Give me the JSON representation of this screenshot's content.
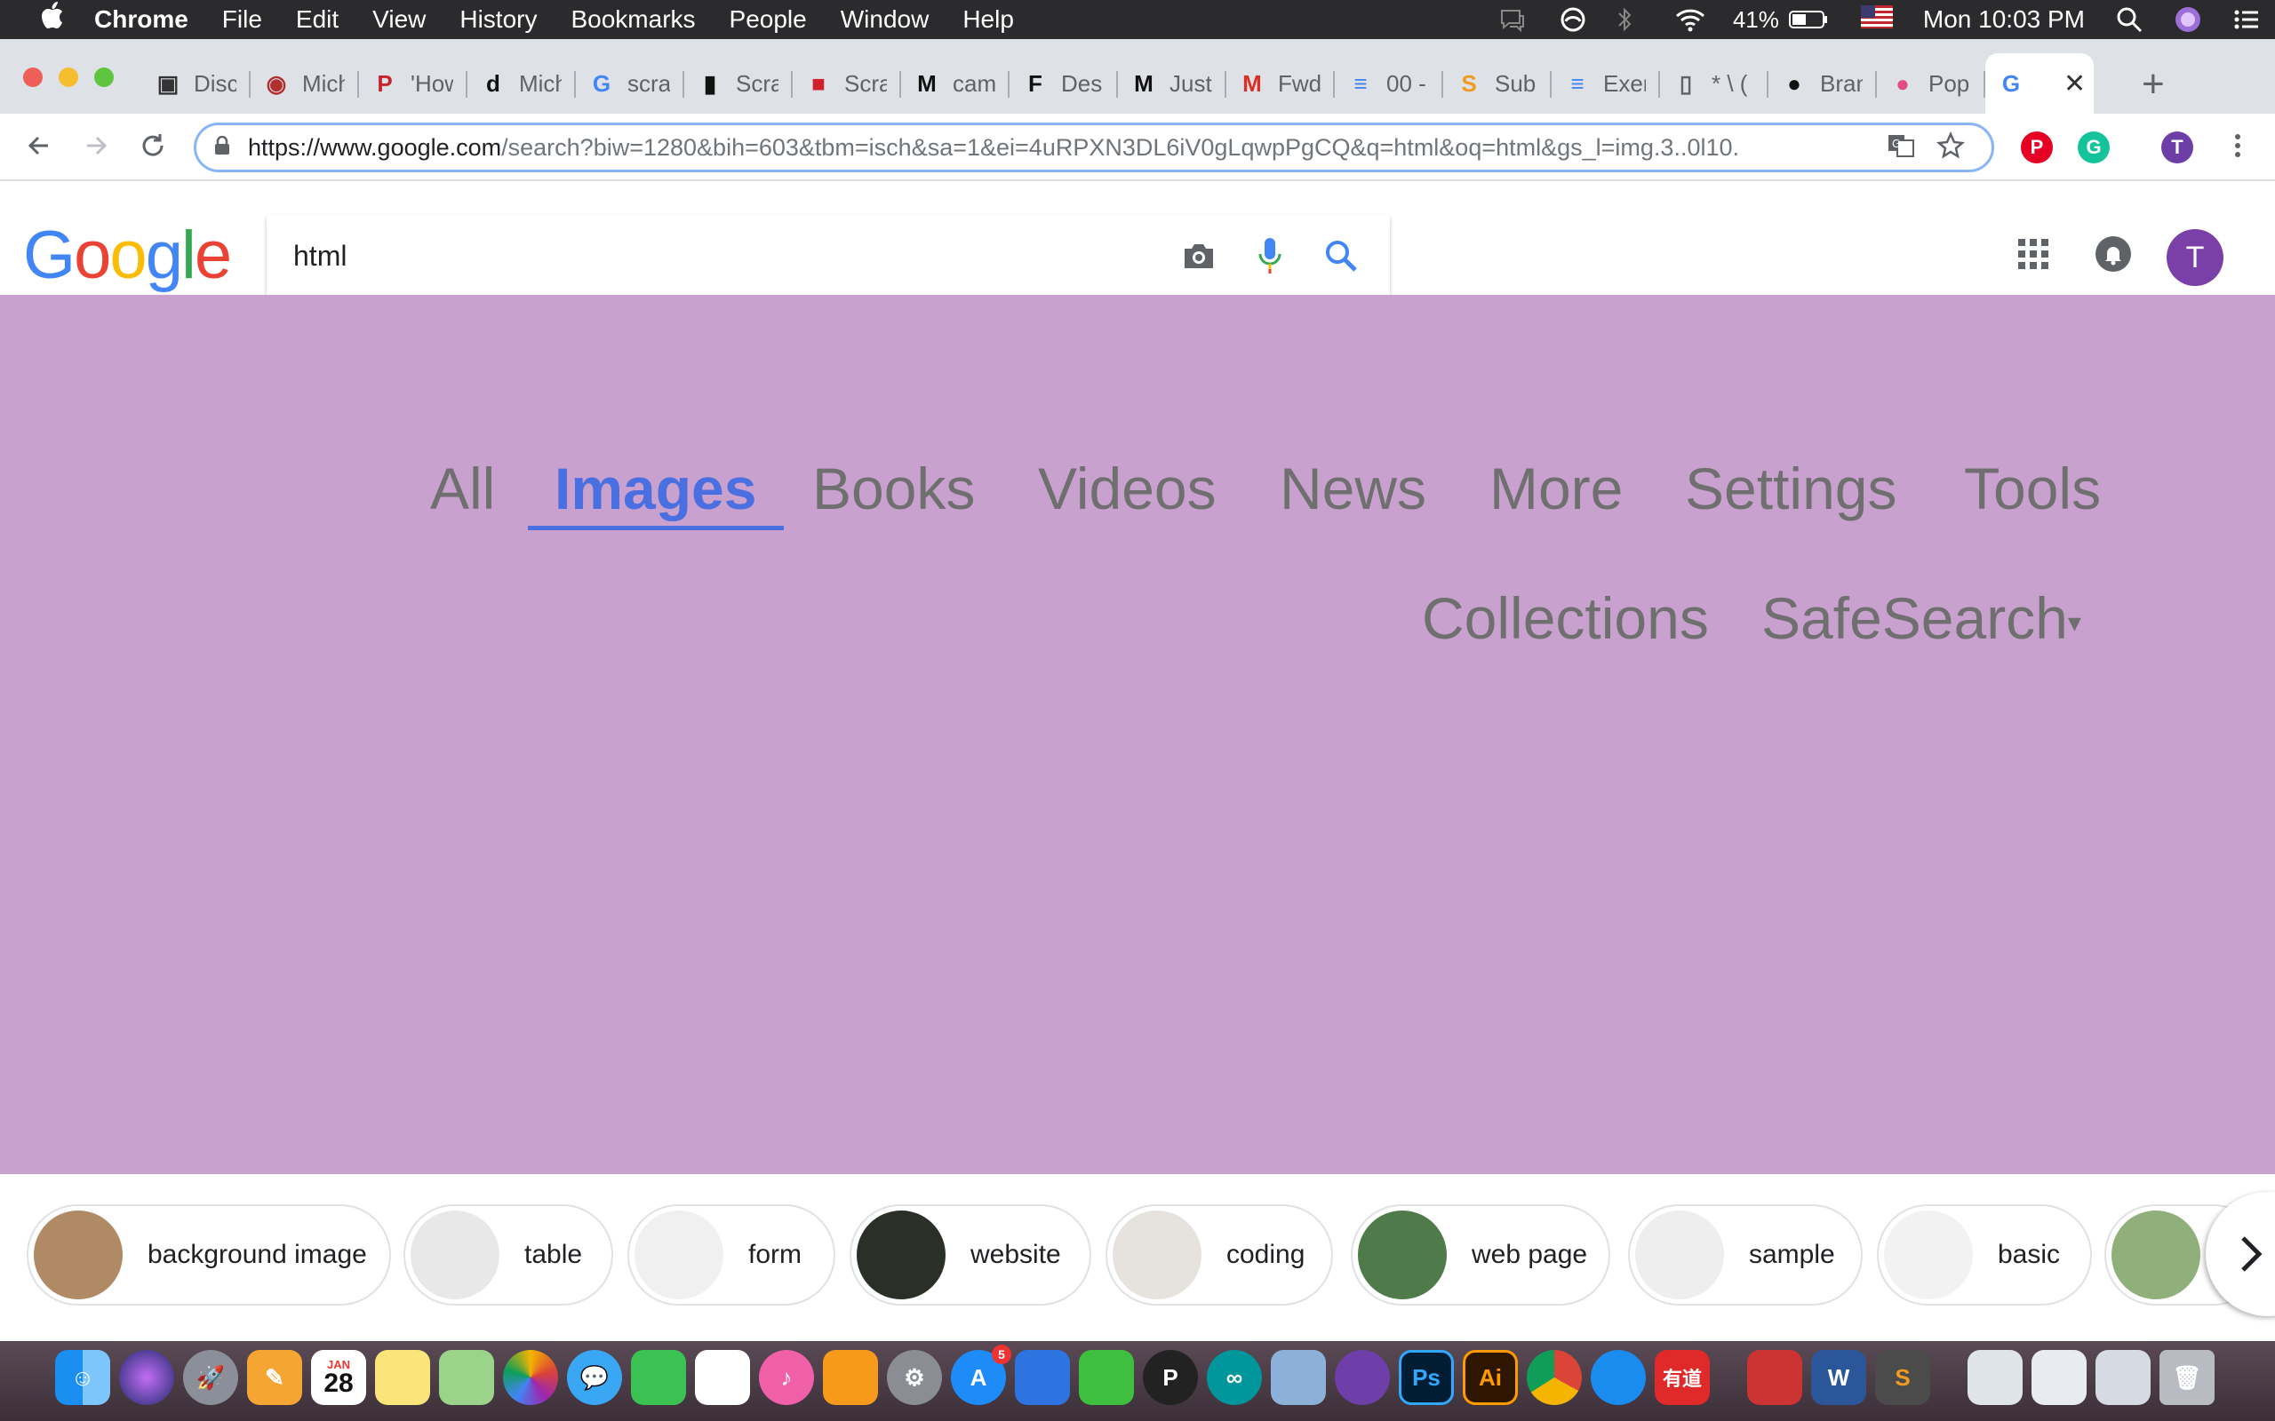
{
  "menubar": {
    "app": "Chrome",
    "items": [
      "File",
      "Edit",
      "View",
      "History",
      "Bookmarks",
      "People",
      "Window",
      "Help"
    ],
    "battery": "41%",
    "clock": "Mon 10:03 PM"
  },
  "tabs": [
    {
      "title": "Disc",
      "icon": "contacts-icon",
      "color": "#333333"
    },
    {
      "title": "Mich",
      "icon": "eye-icon",
      "color": "#b03030"
    },
    {
      "title": "'How",
      "icon": "pinterest-p-icon",
      "color": "#c8232c"
    },
    {
      "title": "Mich",
      "icon": "di-icon",
      "color": "#111111"
    },
    {
      "title": "scra",
      "icon": "google-g-icon",
      "color": "#4285f4"
    },
    {
      "title": "Scra",
      "icon": "phone-icon",
      "color": "#111111"
    },
    {
      "title": "Scra",
      "icon": "red-square-icon",
      "color": "#d0202a"
    },
    {
      "title": "cam",
      "icon": "medium-icon",
      "color": "#111111"
    },
    {
      "title": "Des",
      "icon": "fc-icon",
      "color": "#111111"
    },
    {
      "title": "Just",
      "icon": "medium-icon",
      "color": "#111111"
    },
    {
      "title": "Fwd",
      "icon": "gmail-icon",
      "color": "#d93025"
    },
    {
      "title": "00 -",
      "icon": "docs-icon",
      "color": "#4285f4"
    },
    {
      "title": "Sub",
      "icon": "sublime-icon",
      "color": "#f29a1f"
    },
    {
      "title": "Exer",
      "icon": "docs-icon",
      "color": "#4285f4"
    },
    {
      "title": "* \\ (",
      "icon": "file-icon",
      "color": "#5f6368"
    },
    {
      "title": "Bran",
      "icon": "github-icon",
      "color": "#111111"
    },
    {
      "title": "Pop",
      "icon": "dribbble-icon",
      "color": "#e14c86"
    }
  ],
  "active_tab": {
    "title": "",
    "icon": "google-g-icon"
  },
  "toolbar": {
    "url_host": "https://www.google.com",
    "url_rest": "/search?biw=1280&bih=603&tbm=isch&sa=1&ei=4uRPXN3DL6iV0gLqwpPgCQ&q=html&oq=html&gs_l=img.3..0l10.",
    "avatar_letter": "T"
  },
  "google": {
    "logo_letters": [
      "G",
      "o",
      "o",
      "g",
      "l",
      "e"
    ],
    "logo_colors": [
      "#4285f4",
      "#ea4335",
      "#fbbc05",
      "#4285f4",
      "#34a853",
      "#ea4335"
    ],
    "query": "html",
    "avatar_letter": "T"
  },
  "nav": {
    "links": [
      "All",
      "Images",
      "Books",
      "Videos",
      "News",
      "More",
      "Settings",
      "Tools"
    ],
    "active": "Images",
    "second_row": [
      "Collections",
      "SafeSearch"
    ],
    "safesearch_caret": "▾"
  },
  "chips": [
    {
      "label": "background image",
      "thumb": "#b08a64"
    },
    {
      "label": "table",
      "thumb": "#e8e8e8"
    },
    {
      "label": "form",
      "thumb": "#f0f0f0"
    },
    {
      "label": "website",
      "thumb": "#2a2f28"
    },
    {
      "label": "coding",
      "thumb": "#e6e3df"
    },
    {
      "label": "web page",
      "thumb": "#4f7a4a"
    },
    {
      "label": "sample",
      "thumb": "#eeeeee"
    },
    {
      "label": "basic",
      "thumb": "#f2f2f2"
    },
    {
      "label": "",
      "thumb": "#8fb07a"
    }
  ],
  "dock": {
    "calendar_month": "JAN",
    "calendar_day": "28",
    "appstore_badge": "5",
    "ps_label": "Ps",
    "ai_label": "Ai",
    "youdao_label": "有道"
  }
}
